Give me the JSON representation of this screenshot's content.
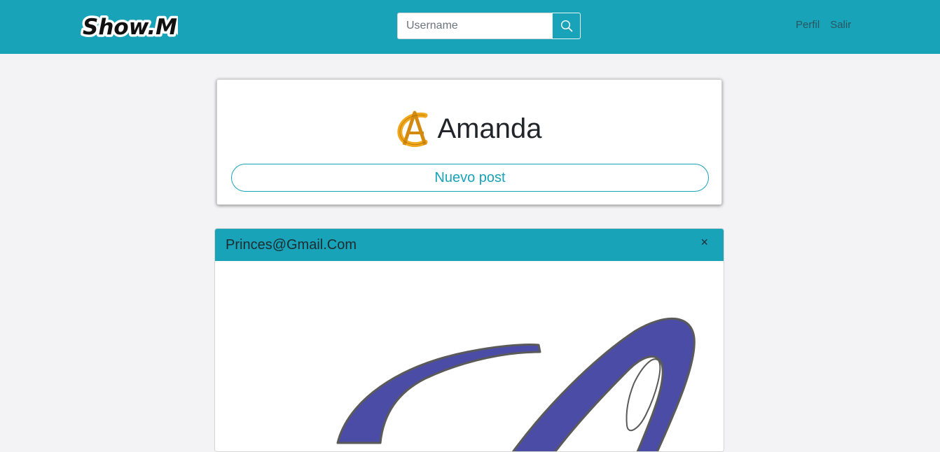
{
  "navbar": {
    "logo_text": "Show.Me",
    "search_placeholder": "Username",
    "links": [
      "Perfil",
      "Salir"
    ]
  },
  "profile": {
    "name": "Amanda",
    "new_post_label": "Nuevo post"
  },
  "post": {
    "author": "Princes@Gmail.Com",
    "close_symbol": "×"
  },
  "colors": {
    "primary": "#18a3b8",
    "background": "#f3f3f5",
    "avatar_gold": "#f2a81d",
    "post_image_blue": "#4b4ca6"
  }
}
